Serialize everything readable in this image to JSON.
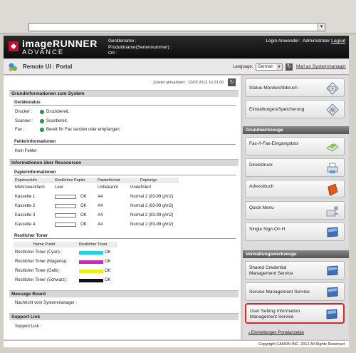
{
  "header": {
    "brand_main": "imageRUNNER",
    "brand_sub": "ADVANCE",
    "device_name_label": "Gerätename :",
    "product_name_label": "Produktname(Seriennummer) :",
    "location_label": "Ort :",
    "login_user_label": "Login Anwender : Administrator",
    "logout_label": "Logout"
  },
  "titlebar": {
    "title": "Remote UI : Portal",
    "language_label": "Language:",
    "language_value": "German",
    "mail_link": "Mail an Systemmanager"
  },
  "main": {
    "last_updated": "Zuletzt aktualisiert : 12/03 2012 16:31:50",
    "section_basic": "Grundinformationen zum System",
    "device_status_head": "Gerätestatus",
    "status": [
      {
        "label": "Drucker :",
        "value": "Druckbereit."
      },
      {
        "label": "Scanner :",
        "value": "Scanbereit."
      },
      {
        "label": "Fax :",
        "value": "Bereit für Fax senden oder empfangen."
      }
    ],
    "error_head": "Fehlerinformationen",
    "error_value": "Kein Fehler",
    "section_resources": "Informationen über Ressourcen",
    "paper_head": "Papierinformationen",
    "paper_columns": [
      "Papierzufuhr",
      "Restliches Papier",
      "Papierformat",
      "Papiertyp"
    ],
    "paper_rows": [
      {
        "source": "Mehrzweckfach",
        "remaining": "Leer",
        "size": "Unbekannt",
        "type": "Undefiniert",
        "bar": false
      },
      {
        "source": "Kassette 1",
        "remaining": "OK",
        "size": "A4",
        "type": "Normal 2 (83-99 g/m2)",
        "bar": true
      },
      {
        "source": "Kassette 2",
        "remaining": "OK",
        "size": "A4",
        "type": "Normal 2 (83-99 g/m2)",
        "bar": true
      },
      {
        "source": "Kassette 3",
        "remaining": "OK",
        "size": "A4",
        "type": "Normal 2 (83-99 g/m2)",
        "bar": true
      },
      {
        "source": "Kassette 4",
        "remaining": "OK",
        "size": "A4",
        "type": "Normal 2 (83-99 g/m2)",
        "bar": true
      }
    ],
    "toner_head": "Restlicher Toner",
    "toner_columns": [
      "Name Punkt",
      "Restlicher Toner"
    ],
    "toner_rows": [
      {
        "name": "Restlicher Toner (Cyan) :",
        "status": "OK",
        "color": "#22d3e6"
      },
      {
        "name": "Restlicher Toner (Magenta) :",
        "status": "OK",
        "color": "#d61fc8"
      },
      {
        "name": "Restlicher Toner (Gelb) :",
        "status": "OK",
        "color": "#f2ec10"
      },
      {
        "name": "Restlicher Toner (Schwarz) :",
        "status": "OK",
        "color": "#111111"
      }
    ],
    "section_message": "Message Board",
    "message_label": "Nachricht vom Systemmanager :",
    "section_support": "Support Link",
    "support_label": "Support Link :"
  },
  "sidebar": {
    "top_buttons": [
      {
        "label": "Status Monitor/Abbruch",
        "icon": "status-monitor-icon"
      },
      {
        "label": "Einstellungen/Speicherung",
        "icon": "settings-icon"
      }
    ],
    "basic_head": "Grundwerkzeuge",
    "basic_buttons": [
      {
        "label": "Fax-/I-Fax-Eingangsbox",
        "icon": "fax-inbox-icon"
      },
      {
        "label": "Direktdruck",
        "icon": "printer-icon"
      },
      {
        "label": "Adressbuch",
        "icon": "address-book-icon"
      },
      {
        "label": "Quick Menu",
        "icon": "quick-menu-icon"
      },
      {
        "label": "Single Sign-On H",
        "icon": "monitor-icon"
      }
    ],
    "admin_head": "Verwaltungswerkzeuge",
    "admin_buttons": [
      {
        "label": "Shared Credential Management Service",
        "icon": "monitor-icon"
      },
      {
        "label": "Service Management Service",
        "icon": "monitor-icon"
      },
      {
        "label": "User Setting Information Management Service",
        "icon": "monitor-icon"
      }
    ],
    "portal_settings_link": "Einstellungen Portalanzeige"
  },
  "footer": {
    "copyright": "Copyright CANON INC. 2012 All Rights Reserved"
  },
  "colors": {
    "status_ok": "#2aa64a",
    "highlight": "#d6242b"
  }
}
